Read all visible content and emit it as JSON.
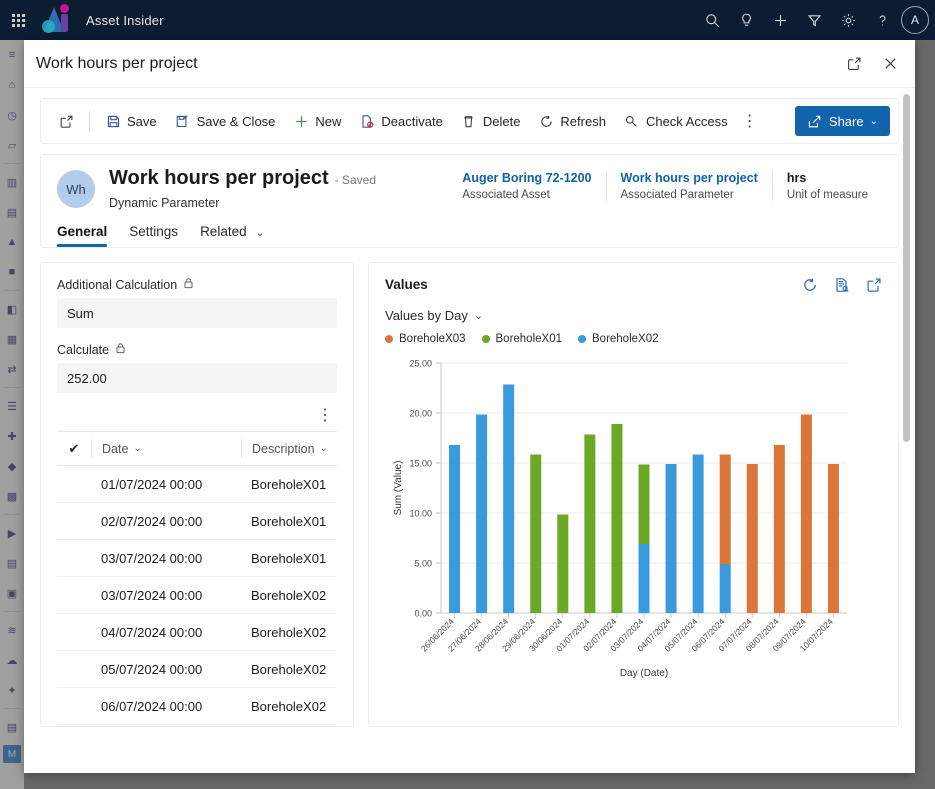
{
  "appbar": {
    "title": "Asset Insider",
    "icons": [
      "search-icon",
      "lightbulb-icon",
      "plus-icon",
      "filter-icon",
      "gear-icon",
      "help-icon"
    ],
    "avatar_initial": "A"
  },
  "left_rail": {
    "badge": "M"
  },
  "dialog": {
    "title": "Work hours per project",
    "popout_label": "Pop out",
    "close_label": "Close"
  },
  "commandbar": {
    "items": [
      {
        "name": "open-record",
        "label": "",
        "icon": "open-record-icon"
      },
      {
        "name": "save",
        "label": "Save",
        "icon": "save-icon"
      },
      {
        "name": "save-and-close",
        "label": "Save & Close",
        "icon": "save-close-icon"
      },
      {
        "name": "new",
        "label": "New",
        "icon": "plus-icon"
      },
      {
        "name": "deactivate",
        "label": "Deactivate",
        "icon": "deactivate-icon"
      },
      {
        "name": "delete",
        "label": "Delete",
        "icon": "trash-icon"
      },
      {
        "name": "refresh",
        "label": "Refresh",
        "icon": "refresh-icon"
      },
      {
        "name": "check-access",
        "label": "Check Access",
        "icon": "key-icon"
      }
    ],
    "overflow_label": "⋮",
    "share_label": "Share"
  },
  "record": {
    "avatar_initials": "Wh",
    "title": "Work hours per project",
    "status": "- Saved",
    "subtitle": "Dynamic Parameter",
    "meta": [
      {
        "value": "Auger Boring 72-1200",
        "label": "Associated Asset",
        "link": true
      },
      {
        "value": "Work hours per project",
        "label": "Associated Parameter",
        "link": true
      },
      {
        "value": "hrs",
        "label": "Unit of measure",
        "link": false
      }
    ],
    "tabs": [
      {
        "label": "General",
        "active": true,
        "chevron": false
      },
      {
        "label": "Settings",
        "active": false,
        "chevron": false
      },
      {
        "label": "Related",
        "active": false,
        "chevron": true
      }
    ]
  },
  "form": {
    "additional_calculation": {
      "label": "Additional Calculation",
      "value": "Sum",
      "locked": true
    },
    "calculate": {
      "label": "Calculate",
      "value": "252.00",
      "locked": true
    }
  },
  "grid": {
    "overflow_label": "⋮",
    "columns": [
      "Date",
      "Description"
    ],
    "rows": [
      {
        "date": "01/07/2024 00:00",
        "description": "BoreholeX01"
      },
      {
        "date": "02/07/2024 00:00",
        "description": "BoreholeX01"
      },
      {
        "date": "03/07/2024 00:00",
        "description": "BoreholeX01"
      },
      {
        "date": "03/07/2024 00:00",
        "description": "BoreholeX02"
      },
      {
        "date": "04/07/2024 00:00",
        "description": "BoreholeX02"
      },
      {
        "date": "05/07/2024 00:00",
        "description": "BoreholeX02"
      },
      {
        "date": "06/07/2024 00:00",
        "description": "BoreholeX02"
      }
    ]
  },
  "chart_panel": {
    "title": "Values",
    "view_selector": "Values by Day",
    "icons": [
      "refresh-icon",
      "view-records-icon",
      "popout-icon"
    ]
  },
  "chart_data": {
    "type": "bar",
    "stacked": true,
    "title": "Values by Day",
    "xlabel": "Day (Date)",
    "ylabel": "Sum (Value)",
    "ylim": [
      0,
      25
    ],
    "yticks": [
      "0.00",
      "5.00",
      "10.00",
      "15.00",
      "20.00",
      "25.00"
    ],
    "grid": true,
    "legend_position": "top",
    "categories": [
      "26/06/2024",
      "27/06/2024",
      "28/06/2024",
      "29/06/2024",
      "30/06/2024",
      "01/07/2024",
      "02/07/2024",
      "03/07/2024",
      "04/07/2024",
      "05/07/2024",
      "06/07/2024",
      "07/07/2024",
      "08/07/2024",
      "09/07/2024",
      "10/07/2024"
    ],
    "series": [
      {
        "name": "BoreholeX02",
        "color": "#3a9bdc",
        "values": [
          16.8,
          19.85,
          22.85,
          0,
          0,
          0,
          0,
          6.9,
          14.9,
          15.85,
          4.9,
          0,
          0,
          0,
          0
        ]
      },
      {
        "name": "BoreholeX01",
        "color": "#6da726",
        "values": [
          0,
          0,
          0,
          15.85,
          9.85,
          17.85,
          18.9,
          7.95,
          0,
          0,
          0,
          0,
          0,
          0,
          0
        ]
      },
      {
        "name": "BoreholeX03",
        "color": "#dd7539",
        "values": [
          0,
          0,
          0,
          0,
          0,
          0,
          0,
          0,
          0,
          0,
          10.95,
          14.9,
          16.8,
          19.85,
          14.9
        ]
      }
    ],
    "totals": [
      16.8,
      19.85,
      22.85,
      15.85,
      9.85,
      17.85,
      18.9,
      14.85,
      14.9,
      15.85,
      15.85,
      14.9,
      16.8,
      19.85,
      14.9
    ],
    "legend": [
      {
        "name": "BoreholeX03",
        "color": "#dd7539"
      },
      {
        "name": "BoreholeX01",
        "color": "#6da726"
      },
      {
        "name": "BoreholeX02",
        "color": "#3a9bdc"
      }
    ]
  }
}
